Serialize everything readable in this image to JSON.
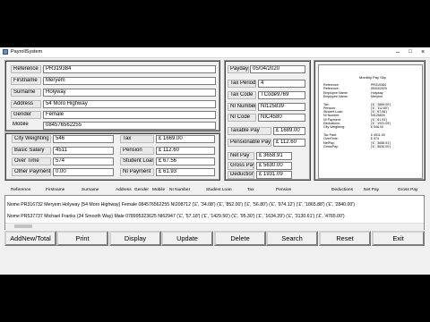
{
  "window": {
    "title": "PayrollSystem"
  },
  "employee": {
    "reference": {
      "label": "Reference",
      "value": "PR319384"
    },
    "firstname": {
      "label": "Firstname",
      "value": "Meryem"
    },
    "surname": {
      "label": "Surname",
      "value": "Holyway"
    },
    "address": {
      "label": "Address",
      "value": "54 Moro Highway"
    },
    "gender": {
      "label": "Gender",
      "value": "Female"
    },
    "mobile": {
      "label": "Mobile",
      "value": "084576562255"
    }
  },
  "pay_info": {
    "payday": {
      "label": "Payday",
      "value": "05/04/2020"
    },
    "tax_period": {
      "label": "Tax Period",
      "value": "4"
    },
    "tax_code": {
      "label": "Tax Code",
      "value": "TCode9769"
    },
    "ni_number": {
      "label": "NI Number",
      "value": "NI125839"
    },
    "ni_code": {
      "label": "NI Code",
      "value": "NIC4580"
    }
  },
  "earnings": {
    "city_weighting": {
      "label": "City Weighting",
      "value": "546"
    },
    "basic_salary": {
      "label": "Basic Salary",
      "value": "4511"
    },
    "over_time": {
      "label": "Over Time",
      "value": "574"
    },
    "other_payment": {
      "label": "Other Payment",
      "value": "0.00"
    }
  },
  "deductions_box": {
    "tax": {
      "label": "Tax",
      "value": "£ 1669.00"
    },
    "pension": {
      "label": "Pension",
      "value": "£ 112.60"
    },
    "student_loan": {
      "label": "Student Loan",
      "value": "£ 67.56"
    },
    "ni_payment": {
      "label": "NI Payment",
      "value": "£ 61.93"
    }
  },
  "totals": {
    "taxable_pay": {
      "label": "Taxable Pay",
      "value": "£ 1689.00"
    },
    "pensionable_pay": {
      "label": "Pensionable Pay",
      "value": "£ 112.60"
    },
    "net_pay": {
      "label": "Net Pay",
      "value": "£ 3658.91"
    },
    "gross_pay": {
      "label": "Gross Pay",
      "value": "£ 5630.00"
    },
    "deductions": {
      "label": "Deductions",
      "value": "£ 1931.09"
    }
  },
  "payslip": {
    "title": "Monthly Pay Slip",
    "rows": [
      {
        "label": "Reference:",
        "value": "PR319384"
      },
      {
        "label": "Reference:",
        "value": "05/04/2020"
      },
      {
        "label": "Employee Name:",
        "value": "Holyway"
      },
      {
        "label": "Employee Name:",
        "value": "Meryem"
      },
      {
        "label": "",
        "value": ""
      },
      {
        "label": "Tax:",
        "value": "('£', '1669.00')"
      },
      {
        "label": "Pension:",
        "value": "('£', '112.60')"
      },
      {
        "label": "Student Loan:",
        "value": "('£', '67.56')"
      },
      {
        "label": "NI Number:",
        "value": "NI125839"
      },
      {
        "label": "NI Payment:",
        "value": "('£', '61.93')"
      },
      {
        "label": "Deductions:",
        "value": "('£', '1931.09')"
      },
      {
        "label": "City Weighting:",
        "value": "£ 546.00"
      },
      {
        "label": "",
        "value": ""
      },
      {
        "label": "Tax Paid:",
        "value": "£ 4511.00"
      },
      {
        "label": "OverTime:",
        "value": "£ 574"
      },
      {
        "label": "NetPay:",
        "value": "('£', '3658.91')"
      },
      {
        "label": "GrossPay:",
        "value": "('£', '5630.00')"
      }
    ]
  },
  "list": {
    "headers": [
      "Reference",
      "Firstname",
      "Surname",
      "Address",
      "Gender",
      "Mobile",
      "NI Number",
      "Student Loan",
      "Tax",
      "Pension",
      "Deductions",
      "Net Pay",
      "Gross Pay"
    ],
    "rows": [
      "Nome PR316732 Meryem Holyway {54 Moro Highway} Female 084576562255 NI208712 ('£', '34.08') ('£', '852.00') ('£', '56.80') ('£', '974.12') ('£', '1865.88') ('£', '2840.00')",
      "Nome PR537737 Michael Franks {34 Smooth Way} Male 078995323625 NI62947 ('£', '57.18') ('£', '1429.50') ('£', '95.30') ('£', '1634.39') ('£', '3130.61') ('£', '4765.00')"
    ]
  },
  "buttons": [
    "AddNew/Total",
    "Print",
    "Display",
    "Update",
    "Delete",
    "Search",
    "Reset",
    "Exit"
  ]
}
